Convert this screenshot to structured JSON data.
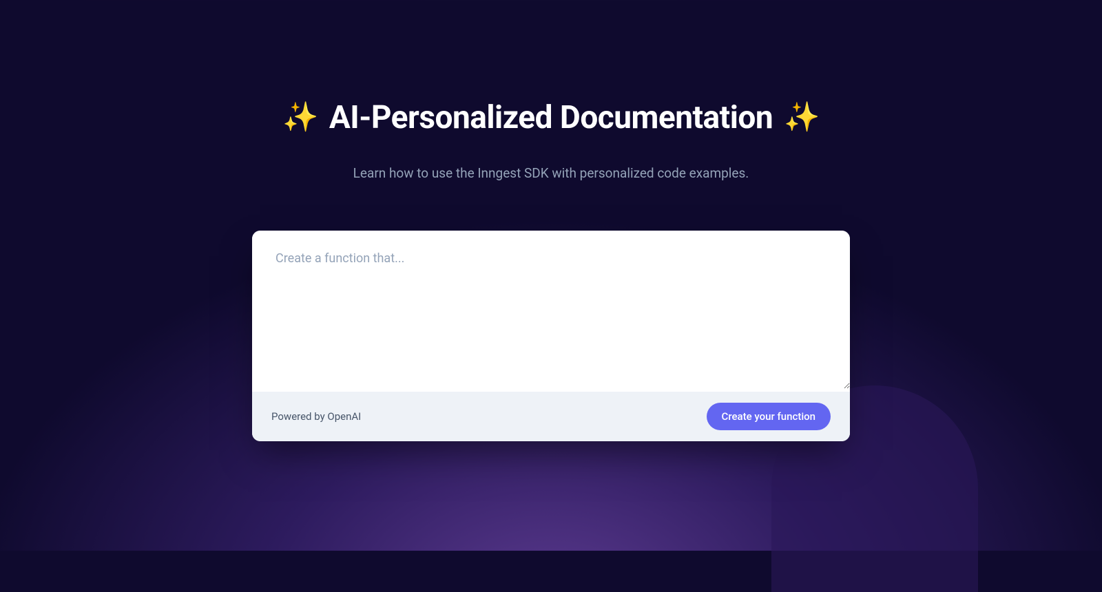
{
  "header": {
    "sparkle_icon": "✨",
    "title": "AI-Personalized Documentation",
    "subtitle": "Learn how to use the Inngest SDK with personalized code examples."
  },
  "card": {
    "textarea": {
      "placeholder": "Create a function that...",
      "value": ""
    },
    "footer": {
      "powered_by": "Powered by OpenAI",
      "button_label": "Create your function"
    }
  }
}
